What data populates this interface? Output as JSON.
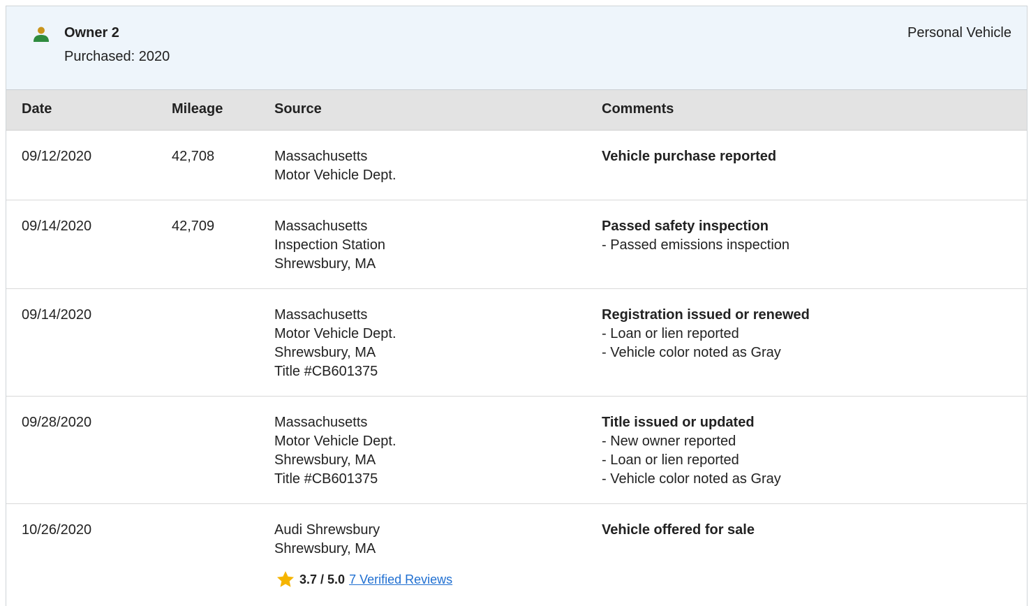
{
  "owner": {
    "name": "Owner 2",
    "purchased": "Purchased: 2020",
    "type": "Personal Vehicle",
    "icon": "person-icon",
    "icon_colors": {
      "head": "#c9941c",
      "body": "#2e8b3e"
    }
  },
  "table": {
    "headers": [
      "Date",
      "Mileage",
      "Source",
      "Comments"
    ],
    "rows": [
      {
        "date": "09/12/2020",
        "mileage": "42,708",
        "source": [
          "Massachusetts",
          "Motor Vehicle Dept."
        ],
        "comment_title": "Vehicle purchase reported",
        "comment_details": []
      },
      {
        "date": "09/14/2020",
        "mileage": "42,709",
        "source": [
          "Massachusetts",
          "Inspection Station",
          "Shrewsbury, MA"
        ],
        "comment_title": "Passed safety inspection",
        "comment_details": [
          "- Passed emissions inspection"
        ]
      },
      {
        "date": "09/14/2020",
        "mileage": "",
        "source": [
          "Massachusetts",
          "Motor Vehicle Dept.",
          "Shrewsbury, MA",
          "Title #CB601375"
        ],
        "comment_title": "Registration issued or renewed",
        "comment_details": [
          "- Loan or lien reported",
          "- Vehicle color noted as Gray"
        ]
      },
      {
        "date": "09/28/2020",
        "mileage": "",
        "source": [
          "Massachusetts",
          "Motor Vehicle Dept.",
          "Shrewsbury, MA",
          "Title #CB601375"
        ],
        "comment_title": "Title issued or updated",
        "comment_details": [
          "- New owner reported",
          "- Loan or lien reported",
          "- Vehicle color noted as Gray"
        ]
      },
      {
        "date": "10/26/2020",
        "mileage": "",
        "source": [
          "Audi Shrewsbury",
          "Shrewsbury, MA"
        ],
        "comment_title": "Vehicle offered for sale",
        "comment_details": [],
        "rating": {
          "value": "3.7 / 5.0",
          "link": "7 Verified Reviews",
          "icon": "star-icon",
          "color": "#f5b400"
        }
      }
    ]
  }
}
